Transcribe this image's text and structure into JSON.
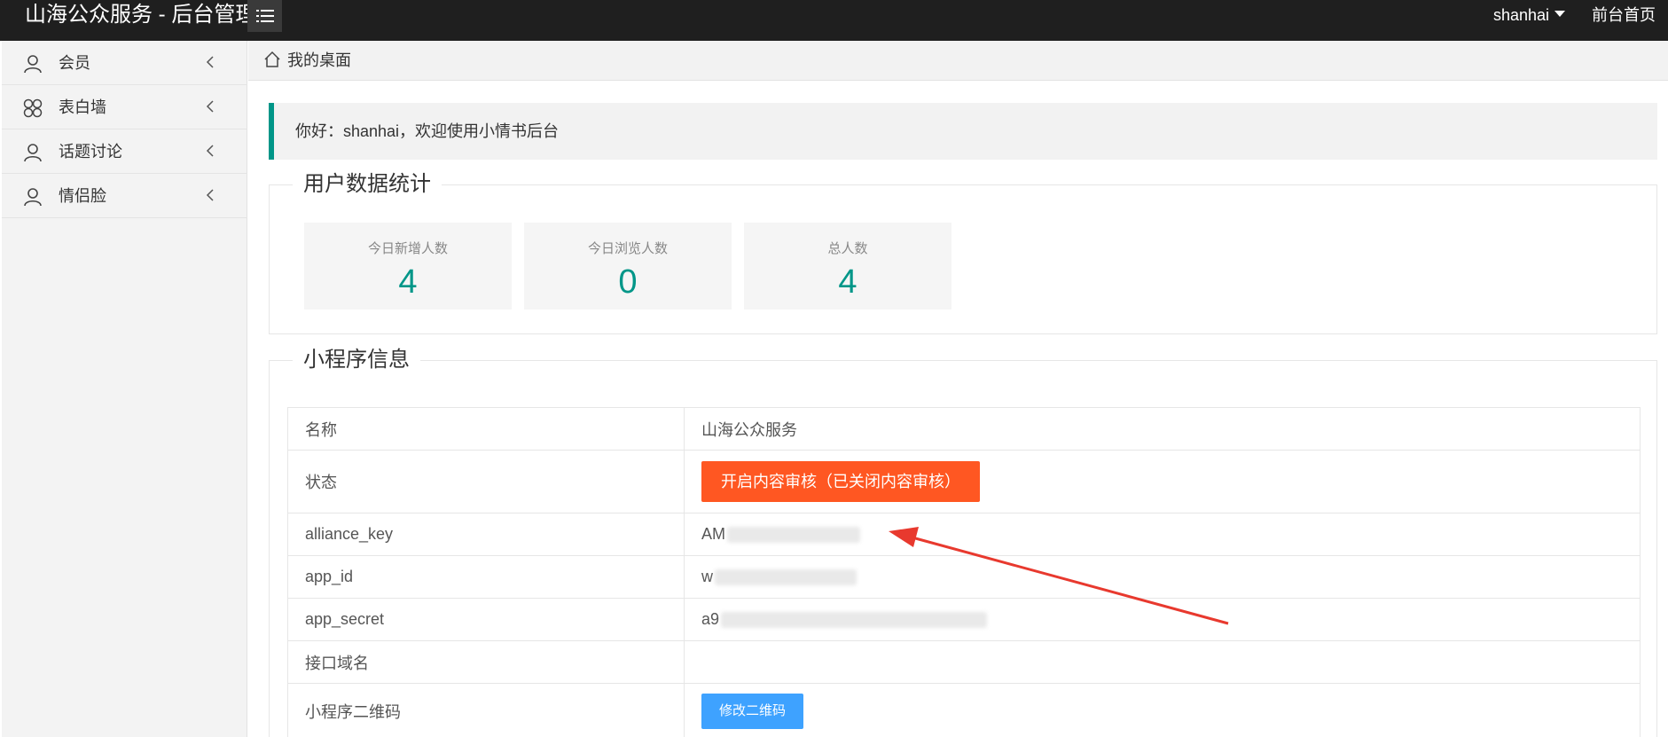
{
  "header": {
    "brand": "山海公众服务 - 后台管理",
    "username": "shanhai",
    "front_link": "前台首页"
  },
  "sidebar": {
    "items": [
      {
        "label": "会员",
        "icon": "user-icon"
      },
      {
        "label": "表白墙",
        "icon": "clover-icon"
      },
      {
        "label": "话题讨论",
        "icon": "user-icon"
      },
      {
        "label": "情侣脸",
        "icon": "user-icon"
      }
    ]
  },
  "breadcrumb": {
    "label": "我的桌面"
  },
  "welcome": {
    "text": "你好：shanhai，欢迎使用小情书后台"
  },
  "stats": {
    "legend": "用户数据统计",
    "cards": [
      {
        "title": "今日新增人数",
        "value": "4"
      },
      {
        "title": "今日浏览人数",
        "value": "0"
      },
      {
        "title": "总人数",
        "value": "4"
      }
    ]
  },
  "mini_program": {
    "legend": "小程序信息",
    "rows": [
      {
        "key": "名称",
        "value": "山海公众服务"
      },
      {
        "key": "状态",
        "button": "开启内容审核（已关闭内容审核）"
      },
      {
        "key": "alliance_key",
        "value": "AM"
      },
      {
        "key": "app_id",
        "value": "w"
      },
      {
        "key": "app_secret",
        "value": "a9"
      },
      {
        "key": "接口域名",
        "value": ""
      },
      {
        "key": "小程序二维码",
        "button": "修改二维码"
      }
    ]
  },
  "colors": {
    "accent": "#009688",
    "orange_button": "#ff5722",
    "blue_button": "#3ea2ff",
    "arrow": "#e8392e"
  }
}
